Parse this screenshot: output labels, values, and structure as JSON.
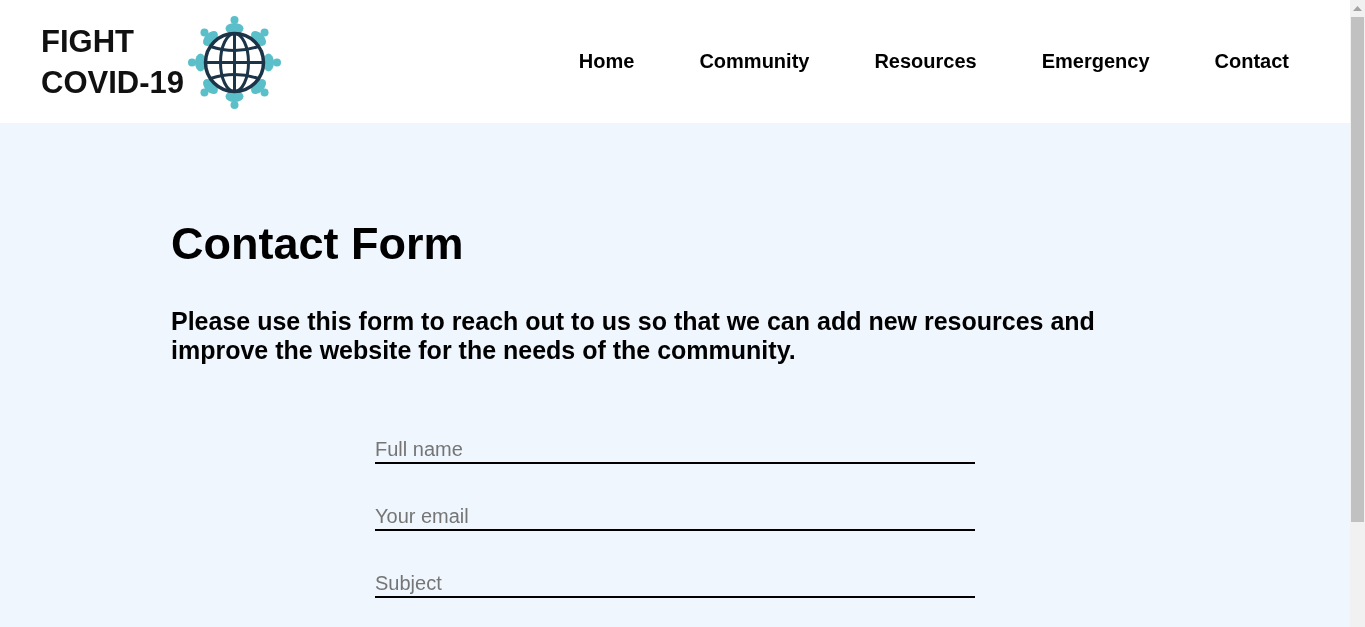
{
  "logo": {
    "lines": [
      "FIGHT",
      "COVID-19"
    ]
  },
  "nav": [
    {
      "label": "Home"
    },
    {
      "label": "Community"
    },
    {
      "label": "Resources"
    },
    {
      "label": "Emergency"
    },
    {
      "label": "Contact"
    }
  ],
  "heading": "Contact Form",
  "intro": "Please use this form to reach out to us so that we can add new resources and improve the website for the needs of the community.",
  "form": {
    "fields": [
      {
        "placeholder": "Full name"
      },
      {
        "placeholder": "Your email"
      },
      {
        "placeholder": "Subject"
      }
    ]
  }
}
